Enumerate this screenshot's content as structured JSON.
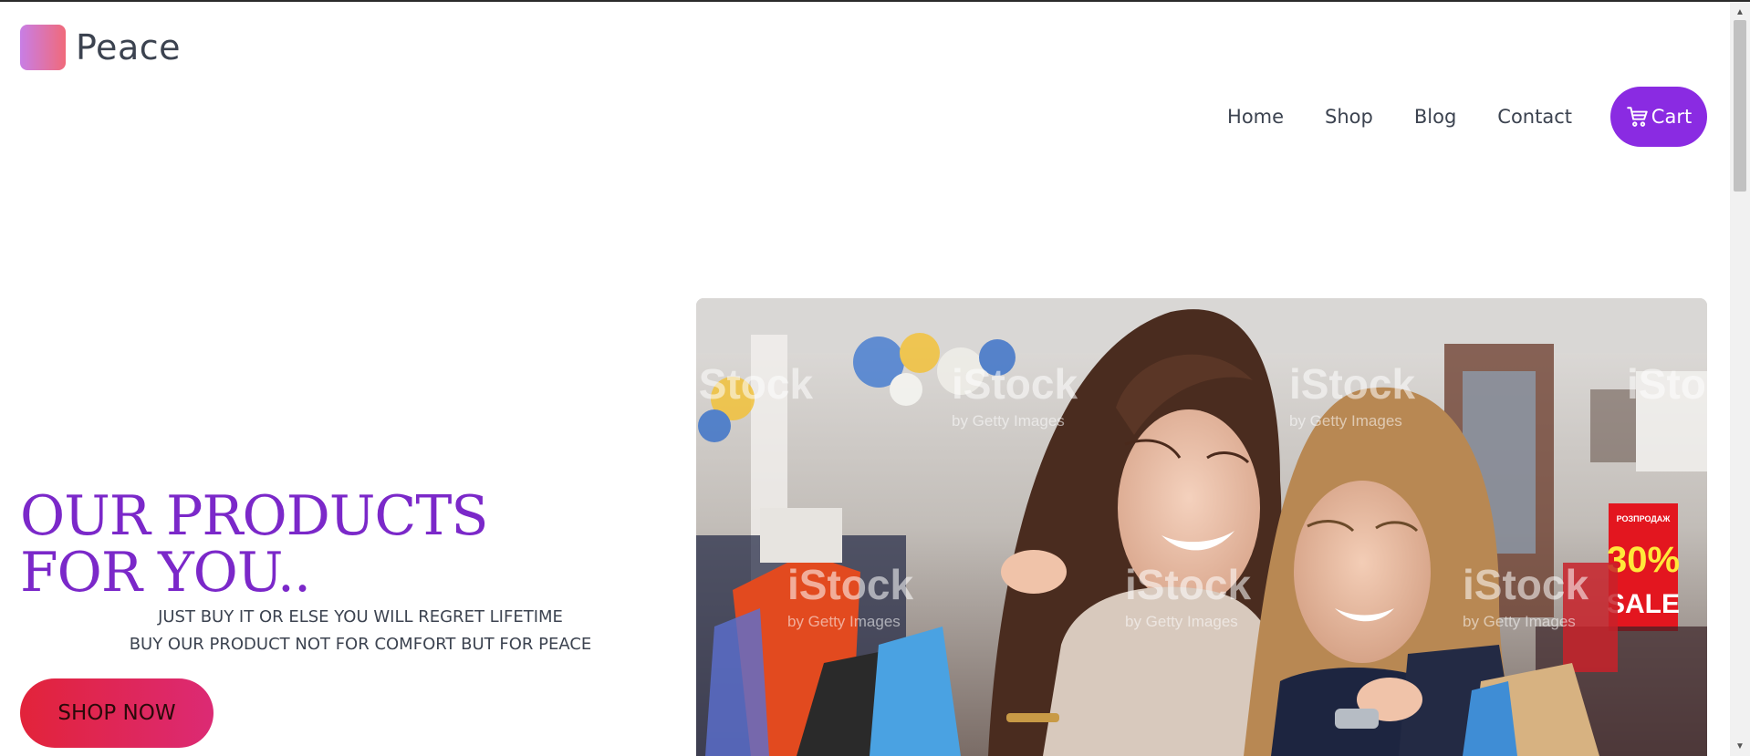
{
  "brand": {
    "name": "Peace"
  },
  "nav": {
    "items": [
      {
        "label": "Home"
      },
      {
        "label": "Shop"
      },
      {
        "label": "Blog"
      },
      {
        "label": "Contact"
      }
    ],
    "cart_label": "Cart",
    "cart_icon": "cart-icon",
    "accent": "#8a2be2"
  },
  "hero": {
    "title": "OUR PRODUCTS FOR YOU..",
    "subtitle_line1": "JUST BUY IT OR ELSE YOU WILL REGRET LIFETIME",
    "subtitle_line2": "BUY OUR PRODUCT NOT FOR COMFORT BUT FOR PEACE",
    "cta_label": "SHOP NOW",
    "title_color": "#7b28c9",
    "cta_gradient": [
      "#e2233a",
      "#dc2a74"
    ],
    "image_sign_discount": "30%",
    "image_sign_sale": "SALE",
    "image_sign_header": "РОЗПРОДАЖ",
    "watermark": "iStock",
    "watermark_sub": "by Getty Images"
  }
}
